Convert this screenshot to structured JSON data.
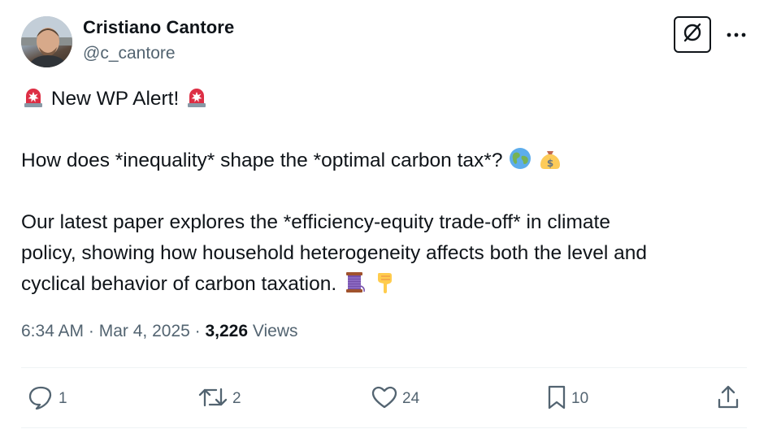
{
  "author": {
    "display_name": "Cristiano Cantore",
    "handle": "@c_cantore"
  },
  "header_icons": {
    "grok": "grok-icon",
    "more": "more-dots-icon"
  },
  "tweet": {
    "line1": "New WP Alert!",
    "line1_emojis": [
      "rotating-light-emoji",
      "rotating-light-emoji"
    ],
    "line2": "How does *inequality* shape the *optimal carbon tax*?",
    "line2_emojis": [
      "globe-emoji",
      "money-bag-emoji"
    ],
    "line3a": "Our latest paper explores the *efficiency-equity trade-off* in climate",
    "line3b": "policy, showing how household heterogeneity affects both the level and",
    "line3c": "cyclical behavior of carbon taxation.",
    "line3_emojis": [
      "thread-emoji",
      "pointing-down-emoji"
    ]
  },
  "meta": {
    "time": "6:34 AM",
    "separator": " · ",
    "date": "Mar 4, 2025",
    "views_count": "3,226",
    "views_label": "Views"
  },
  "actions": {
    "replies": "1",
    "reposts": "2",
    "likes": "24",
    "bookmarks": "10"
  },
  "colors": {
    "text": "#0f1419",
    "secondary": "#536471",
    "divider": "#eff3f4"
  }
}
